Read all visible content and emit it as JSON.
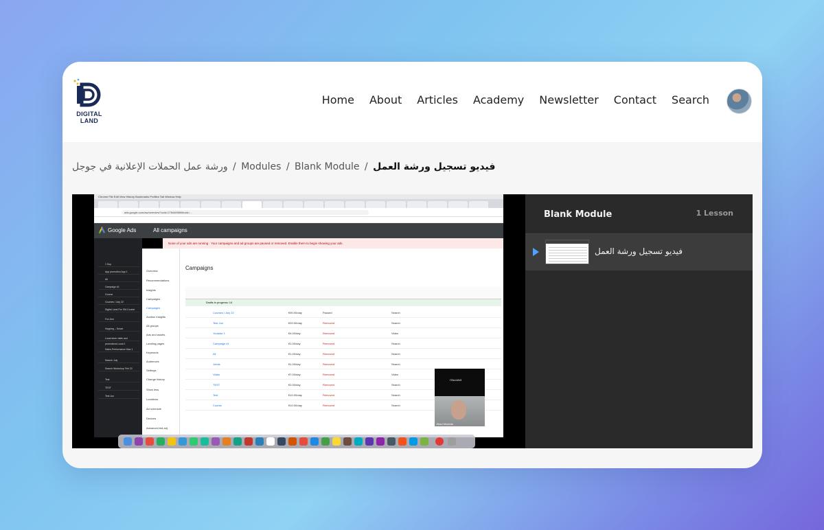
{
  "header": {
    "logo_text_1": "DIGITAL",
    "logo_text_2": "LAND",
    "nav": [
      "Home",
      "About",
      "Articles",
      "Academy",
      "Newsletter",
      "Contact",
      "Search"
    ]
  },
  "breadcrumb": {
    "course": "ورشة عمل الحملات الإعلانية في جوجل",
    "modules": "Modules",
    "module": "Blank Module",
    "current": "فيديو تسجيل ورشة العمل",
    "separator": "/"
  },
  "video": {
    "menubar": "Chrome  File  Edit  View  History  Bookmarks  Profiles  Tab  Window  Help",
    "url": "ads.google.com/aw/overview?ocid=2784469698euid=...",
    "brand": "Google Ads",
    "section": "All campaigns",
    "banner": "None of your ads are running · Your campaigns and ad groups are paused or removed. Enable them to begin showing your ads.",
    "page_title": "Campaigns",
    "left_nav": [
      "Overview",
      "Recommendations",
      "Insights",
      "Campaigns",
      "Campaigns",
      "Auction insights",
      "All groups",
      "Ads and assets",
      "Landing pages",
      "Keywords",
      "Audiences",
      "Settings",
      "Change history",
      "Show less",
      "Locations",
      "Ad schedule",
      "Devices",
      "Advanced bid adj."
    ],
    "sidebar_campaigns": [
      "1 Sup",
      "App promotion App 1",
      "All",
      "Campaign #1",
      "Course",
      "Courses i July 22",
      "Digital Land For ISA Course",
      "Fox Ann",
      "Hopping – Smart",
      "Local store visits and promotions Local 1",
      "Sales-Performance Max 1",
      "Search July",
      "Search Workshop Feb 23",
      "Test",
      "TEST",
      "Test Jun"
    ],
    "group_label": "Drafts in progress: 14",
    "rows": [
      {
        "name": "Courses i July 22",
        "budget": "€90.00/day",
        "status": "Paused",
        "type": "Search"
      },
      {
        "name": "Test Jun",
        "budget": "€20.00/day",
        "status": "Removed",
        "type": "Search"
      },
      {
        "name": "Youtube 1",
        "budget": "€4.00/day",
        "status": "Removed",
        "type": "Video"
      },
      {
        "name": "Campaign #1",
        "budget": "€1.00/day",
        "status": "Removed",
        "type": "Search"
      },
      {
        "name": "All",
        "budget": "€1.00/day",
        "status": "Removed",
        "type": "Search"
      },
      {
        "name": "Johds",
        "budget": "€1.00/day",
        "status": "Removed",
        "type": "Search"
      },
      {
        "name": "Video",
        "budget": "€7.00/day",
        "status": "Removed",
        "type": "Video"
      },
      {
        "name": "TEST",
        "budget": "€2.00/day",
        "status": "Removed",
        "type": "Search"
      },
      {
        "name": "Test",
        "budget": "€10.00/day",
        "status": "Removed",
        "type": "Search"
      },
      {
        "name": "Course",
        "budget": "€10.00/day",
        "status": "Removed",
        "type": "Search"
      }
    ],
    "webcam_top_label": "ITALIAN3",
    "webcam_name": "Jihad Mustafa"
  },
  "panel": {
    "title": "Blank Module",
    "count": "1 Lesson",
    "lesson_title": "فيديو تسجيل ورشة العمل"
  },
  "colors": {
    "accent": "#4da3ff",
    "panel_bg": "#2a2a2a",
    "lesson_active_bg": "#3c3c3c",
    "logo_navy": "#1a2a56"
  }
}
